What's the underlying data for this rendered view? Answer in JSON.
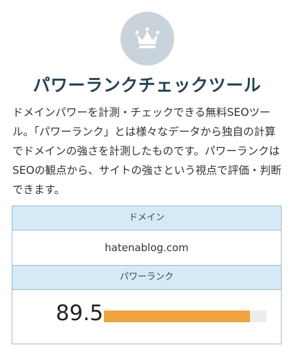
{
  "header": {
    "icon": "crown-icon",
    "title": "パワーランクチェックツール"
  },
  "description": "ドメインパワーを計測・チェックできる無料SEOツール。「パワーランク」とは様々なデータから独自の計算でドメインの強さを計測したものです。パワーランクはSEOの観点から、サイトの強さという視点で評価・判断できます。",
  "result_table": {
    "domain_header": "ドメイン",
    "domain_value": "hatenablog.com",
    "rank_header": "パワーランク",
    "rank_value": "89.5",
    "rank_bar_fraction": 0.9,
    "rank_bar_color": "#f0a33a"
  },
  "colors": {
    "icon_circle": "#c9d3dc",
    "title": "#244455",
    "table_header_bg": "#d4eaf6",
    "table_border": "#9fb8c8"
  }
}
